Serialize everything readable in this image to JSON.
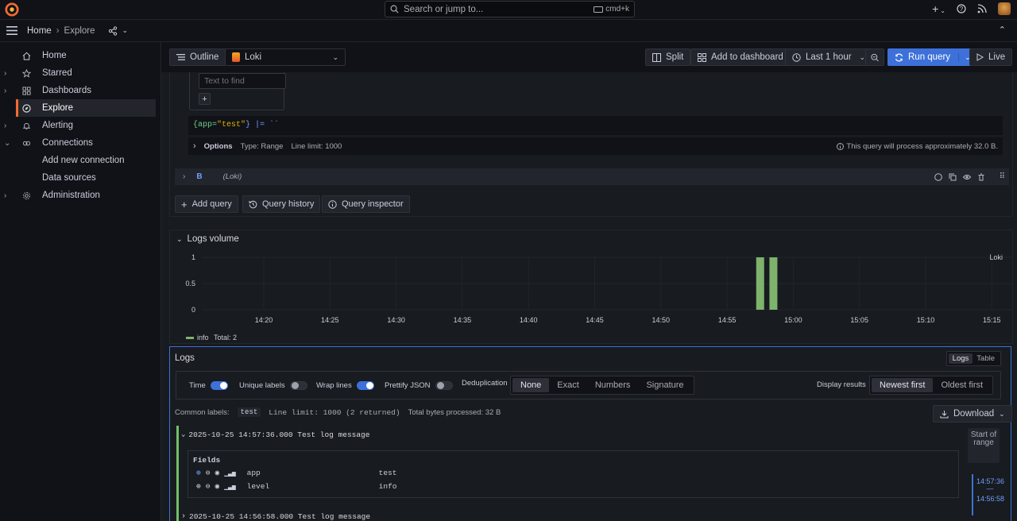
{
  "topbar": {
    "search_placeholder": "Search or jump to...",
    "search_shortcut": "cmd+k"
  },
  "breadcrumb": {
    "home": "Home",
    "current": "Explore"
  },
  "sidebar": {
    "items": [
      {
        "label": "Home",
        "icon": "home-icon"
      },
      {
        "label": "Starred",
        "icon": "star-icon"
      },
      {
        "label": "Dashboards",
        "icon": "apps-icon"
      },
      {
        "label": "Explore",
        "icon": "compass-icon"
      },
      {
        "label": "Alerting",
        "icon": "bell-icon"
      },
      {
        "label": "Connections",
        "icon": "link-icon"
      },
      {
        "label": "Add new connection",
        "icon": ""
      },
      {
        "label": "Data sources",
        "icon": ""
      },
      {
        "label": "Administration",
        "icon": "cog-icon"
      }
    ]
  },
  "toolbar": {
    "outline": "Outline",
    "datasource": "Loki",
    "split": "Split",
    "add_to_dashboard": "Add to dashboard",
    "time_range": "Last 1 hour",
    "run_query": "Run query",
    "live": "Live"
  },
  "query": {
    "find_placeholder": "Text to find",
    "expr_prefix": "{app=",
    "expr_value": "\"test\"",
    "expr_suffix": "} |= ``",
    "options_label": "Options",
    "options_type": "Type: Range",
    "options_limit": "Line limit: 1000",
    "process_note": "This query will process approximately 32.0 B.",
    "b_label": "B",
    "b_datasource": "(Loki)"
  },
  "query_actions": {
    "add_query": "Add query",
    "query_history": "Query history",
    "query_inspector": "Query inspector"
  },
  "chart_data": {
    "type": "bar",
    "title": "Logs volume",
    "x": [
      "14:57",
      "14:58"
    ],
    "series": [
      {
        "name": "info",
        "values": [
          1,
          1
        ],
        "color": "#7eb26d"
      }
    ],
    "xticks": [
      "14:20",
      "14:25",
      "14:30",
      "14:35",
      "14:40",
      "14:45",
      "14:50",
      "14:55",
      "15:00",
      "15:05",
      "15:10",
      "15:15"
    ],
    "yticks": [
      "0",
      "0.5",
      "1"
    ],
    "ylim": [
      0,
      1
    ],
    "legend": "info",
    "legend_total": "Total: 2",
    "corner_label": "Loki"
  },
  "logs": {
    "title": "Logs",
    "view_logs": "Logs",
    "view_table": "Table",
    "time": "Time",
    "unique_labels": "Unique labels",
    "wrap_lines": "Wrap lines",
    "prettify_json": "Prettify JSON",
    "deduplication": "Deduplication",
    "dedup_options": [
      "None",
      "Exact",
      "Numbers",
      "Signature"
    ],
    "display_results": "Display results",
    "order_newest": "Newest first",
    "order_oldest": "Oldest first",
    "common_labels": "Common labels:",
    "common_label_value": "test",
    "line_limit": "Line limit: 1000 (2 returned)",
    "total_bytes": "Total bytes processed:  32 B",
    "download": "Download",
    "rows": [
      {
        "text": "2025-10-25 14:57:36.000 Test log message"
      },
      {
        "text": "2025-10-25 14:56:58.000 Test log message"
      }
    ],
    "fields_title": "Fields",
    "fields": [
      {
        "key": "app",
        "value": "test"
      },
      {
        "key": "level",
        "value": "info"
      }
    ],
    "start_of_range": "Start of range",
    "range_top": "14:57:36",
    "range_dash": "—",
    "range_bottom": "14:56:58"
  }
}
